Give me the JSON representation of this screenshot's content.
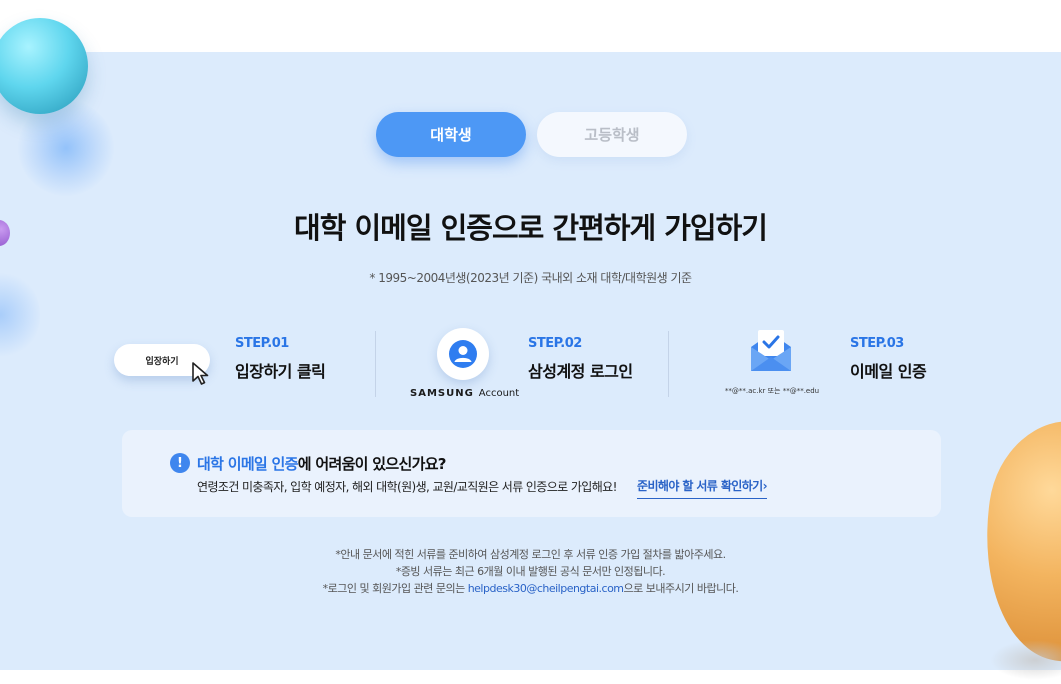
{
  "tabs": [
    {
      "label": "대학생",
      "active": true
    },
    {
      "label": "고등학생",
      "active": false
    }
  ],
  "headline": "대학 이메일 인증으로 간편하게 가입하기",
  "subnote": "* 1995~2004년생(2023년 기준) 국내외 소재 대학/대학원생 기준",
  "steps": [
    {
      "num": "STEP.01",
      "title": "입장하기 클릭",
      "button_label": "입장하기",
      "icon": "cursor-icon"
    },
    {
      "num": "STEP.02",
      "title": "삼성계정 로그인",
      "brand": "SAMSUNG",
      "brand_suffix": "Account",
      "icon": "user-icon"
    },
    {
      "num": "STEP.03",
      "title": "이메일 인증",
      "email_sample": "**@**.ac.kr 또는 **@**.edu",
      "icon": "envelope-check-icon"
    }
  ],
  "help": {
    "icon_text": "!",
    "title_highlight": "대학 이메일 인증",
    "title_rest": "에 어려움이 있으신가요?",
    "description": "연령조건 미충족자, 입학 예정자, 해외 대학(원)생, 교원/교직원은 서류 인증으로 가입해요!",
    "link_label": "준비해야 할 서류 확인하기"
  },
  "notes": {
    "line1": "*안내 문서에 적힌 서류를 준비하여 삼성계정 로그인 후 서류 인증 가입 절차를 밟아주세요.",
    "line2": "*증빙 서류는 최근 6개월 이내 발행된 공식 문서만 인정됩니다.",
    "line3_prefix": "*로그인 및 회원가입 관련 문의는 ",
    "line3_email": "helpdesk30@cheilpengtai.com",
    "line3_suffix": "으로 보내주시기 바랍니다."
  },
  "colors": {
    "background": "#dcebfc",
    "accent": "#4d98f5",
    "step_blue": "#2a75e6",
    "link_blue": "#2a63c7"
  }
}
